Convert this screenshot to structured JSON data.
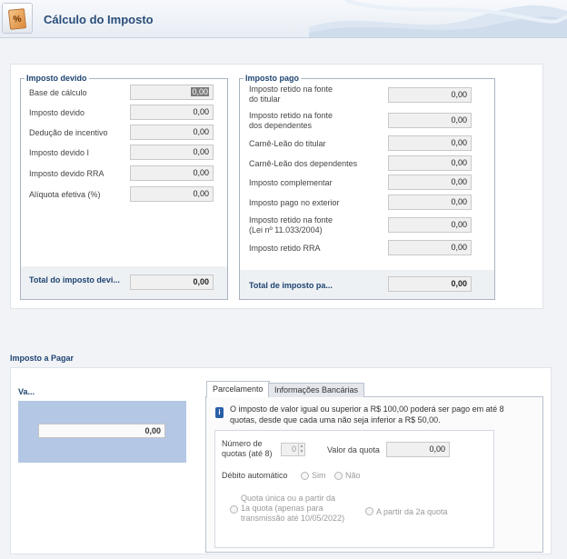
{
  "header": {
    "title": "Cálculo do Imposto",
    "icon": "percent-document-icon",
    "icon_glyph": "%"
  },
  "imposto_devido": {
    "legend": "Imposto devido",
    "rows": [
      {
        "label": "Base de cálculo",
        "value": "0,00"
      },
      {
        "label": "Imposto devido",
        "value": "0,00"
      },
      {
        "label": "Dedução de incentivo",
        "value": "0,00"
      },
      {
        "label": "Imposto devido I",
        "value": "0,00"
      },
      {
        "label": "Imposto devido RRA",
        "value": "0,00"
      },
      {
        "label": "Alíquota efetiva (%)",
        "value": "0,00"
      }
    ],
    "total_label": "Total do imposto devi...",
    "total_value": "0,00"
  },
  "imposto_pago": {
    "legend": "Imposto pago",
    "rows": [
      {
        "label": "Imposto retido na fonte",
        "label2": "do titular",
        "value": "0,00"
      },
      {
        "label": "Imposto retido na fonte",
        "label2": "dos dependentes",
        "value": "0,00"
      },
      {
        "label": "Carnê-Leão do titular",
        "value": "0,00"
      },
      {
        "label": "Carnê-Leão dos dependentes",
        "value": "0,00"
      },
      {
        "label": "Imposto complementar",
        "value": "0,00"
      },
      {
        "label": "Imposto pago no exterior",
        "value": "0,00"
      },
      {
        "label": "Imposto retido na fonte",
        "label2": "(Lei nº 11.033/2004)",
        "value": "0,00"
      },
      {
        "label": "Imposto retido RRA",
        "value": "0,00"
      }
    ],
    "total_label": "Total de imposto pa...",
    "total_value": "0,00"
  },
  "imposto_a_pagar": {
    "title": "Imposto a Pagar",
    "va_label": "Va...",
    "va_value": "0,00"
  },
  "tabs": [
    {
      "label": "Parcelamento",
      "active": true
    },
    {
      "label": "Informações Bancárias",
      "active": false
    }
  ],
  "parcelamento": {
    "info_line1": "O imposto de valor igual ou superior a R$ 100,00 poderá ser pago em até 8",
    "info_line2": "quotas, desde que cada uma não seja inferior a R$ 50,00.",
    "num_quotas_label1": "Número de",
    "num_quotas_label2": "quotas (até 8)",
    "num_quotas_value": "0",
    "valor_quota_label": "Valor da quota",
    "valor_quota_value": "0,00",
    "debito_label": "Débito automático",
    "debito_sim": "Sim",
    "debito_nao": "Não",
    "quota_unica_line1": "Quota única ou a partir da",
    "quota_unica_line2": "1a quota (apenas para",
    "quota_unica_line3": "transmissão até 10/05/2022)",
    "segunda_quota": "A partir da 2a quota"
  }
}
